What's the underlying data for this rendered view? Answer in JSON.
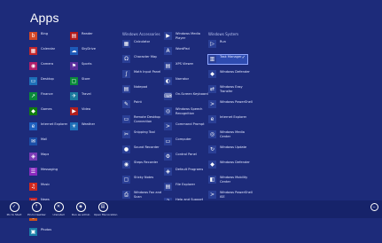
{
  "screen": {
    "title": "Apps"
  },
  "columns": [
    {
      "header": "",
      "tiles": [
        {
          "label": "Bing",
          "icon": "bing-icon",
          "color": "#d24726",
          "glyph": "b"
        },
        {
          "label": "Calendar",
          "icon": "calendar-icon",
          "color": "#c1272d",
          "glyph": "▦"
        },
        {
          "label": "Camera",
          "icon": "camera-icon",
          "color": "#b01e6a",
          "glyph": "◉"
        },
        {
          "label": "Desktop",
          "icon": "desktop-icon",
          "color": "#1e6fb8",
          "glyph": "▭"
        },
        {
          "label": "Finance",
          "icon": "finance-icon",
          "color": "#0a8a3a",
          "glyph": "↗"
        },
        {
          "label": "Games",
          "icon": "games-icon",
          "color": "#107c10",
          "glyph": "◆"
        },
        {
          "label": "Internet Explorer",
          "icon": "internet-explorer-icon",
          "color": "#1f5fbf",
          "glyph": "e"
        },
        {
          "label": "Mail",
          "icon": "mail-icon",
          "color": "#1b4fa8",
          "glyph": "✉"
        },
        {
          "label": "Maps",
          "icon": "maps-icon",
          "color": "#7a3bb5",
          "glyph": "◈"
        },
        {
          "label": "Messaging",
          "icon": "messaging-icon",
          "color": "#8a2bbf",
          "glyph": "☰"
        },
        {
          "label": "Music",
          "icon": "music-icon",
          "color": "#d1281e",
          "glyph": "♫"
        },
        {
          "label": "News",
          "icon": "news-icon",
          "color": "#c1272d",
          "glyph": "▤"
        },
        {
          "label": "People",
          "icon": "people-icon",
          "color": "#c9511a",
          "glyph": "☺"
        },
        {
          "label": "Photos",
          "icon": "photos-icon",
          "color": "#1a7fa8",
          "glyph": "▣"
        }
      ]
    },
    {
      "header": "",
      "tiles": [
        {
          "label": "Reader",
          "icon": "reader-icon",
          "color": "#b31a1a",
          "glyph": "▤"
        },
        {
          "label": "SkyDrive",
          "icon": "skydrive-icon",
          "color": "#1e5ab8",
          "glyph": "☁"
        },
        {
          "label": "Sports",
          "icon": "sports-icon",
          "color": "#5a2d9c",
          "glyph": "⚑"
        },
        {
          "label": "Store",
          "icon": "store-icon",
          "color": "#0a8a3a",
          "glyph": "▢"
        },
        {
          "label": "Travel",
          "icon": "travel-icon",
          "color": "#1b7a9e",
          "glyph": "✈"
        },
        {
          "label": "Video",
          "icon": "video-icon",
          "color": "#b01e1e",
          "glyph": "▶"
        },
        {
          "label": "Weather",
          "icon": "weather-icon",
          "color": "#1e6fb8",
          "glyph": "☀"
        }
      ]
    },
    {
      "header": "Windows Accessories",
      "tiles": [
        {
          "label": "Calculator",
          "icon": "calculator-icon",
          "color": "#2a3f96",
          "glyph": "▦"
        },
        {
          "label": "Character Map",
          "icon": "character-map-icon",
          "color": "#2a3f96",
          "glyph": "Ω"
        },
        {
          "label": "Math Input Panel",
          "icon": "math-input-panel-icon",
          "color": "#2a3f96",
          "glyph": "∫"
        },
        {
          "label": "Notepad",
          "icon": "notepad-icon",
          "color": "#2a3f96",
          "glyph": "▤"
        },
        {
          "label": "Paint",
          "icon": "paint-icon",
          "color": "#2a3f96",
          "glyph": "✎"
        },
        {
          "label": "Remote Desktop Connection",
          "icon": "remote-desktop-icon",
          "color": "#2a3f96",
          "glyph": "▭"
        },
        {
          "label": "Snipping Tool",
          "icon": "snipping-tool-icon",
          "color": "#2a3f96",
          "glyph": "✂"
        },
        {
          "label": "Sound Recorder",
          "icon": "sound-recorder-icon",
          "color": "#2a3f96",
          "glyph": "●"
        },
        {
          "label": "Steps Recorder",
          "icon": "steps-recorder-icon",
          "color": "#2a3f96",
          "glyph": "◉"
        },
        {
          "label": "Sticky Notes",
          "icon": "sticky-notes-icon",
          "color": "#2a3f96",
          "glyph": "▢"
        },
        {
          "label": "Windows Fax and Scan",
          "icon": "fax-scan-icon",
          "color": "#2a3f96",
          "glyph": "⎙"
        },
        {
          "label": "Windows Journal",
          "icon": "windows-journal-icon",
          "color": "#2a3f96",
          "glyph": "✎"
        }
      ]
    },
    {
      "header": "",
      "tiles": [
        {
          "label": "Windows Media Player",
          "icon": "media-player-icon",
          "color": "#2a3f96",
          "glyph": "▶"
        },
        {
          "label": "WordPad",
          "icon": "wordpad-icon",
          "color": "#2a3f96",
          "glyph": "A"
        },
        {
          "label": "XPS Viewer",
          "icon": "xps-viewer-icon",
          "color": "#2a3f96",
          "glyph": "▤"
        },
        {
          "label": "Narrator",
          "icon": "narrator-icon",
          "color": "#2a3f96",
          "glyph": "◐"
        },
        {
          "label": "On-Screen Keyboard",
          "icon": "on-screen-keyboard-icon",
          "color": "#2a3f96",
          "glyph": "⌨"
        },
        {
          "label": "Windows Speech Recognition",
          "icon": "speech-recognition-icon",
          "color": "#2a3f96",
          "glyph": "◎"
        },
        {
          "label": "Command Prompt",
          "icon": "command-prompt-icon",
          "color": "#2a3f96",
          "glyph": ">"
        },
        {
          "label": "Computer",
          "icon": "computer-icon",
          "color": "#2a3f96",
          "glyph": "▭"
        },
        {
          "label": "Control Panel",
          "icon": "control-panel-icon",
          "color": "#2a3f96",
          "glyph": "⚙"
        },
        {
          "label": "Default Programs",
          "icon": "default-programs-icon",
          "color": "#2a3f96",
          "glyph": "◈"
        },
        {
          "label": "File Explorer",
          "icon": "file-explorer-icon",
          "color": "#2a3f96",
          "glyph": "▤"
        },
        {
          "label": "Help and Support",
          "icon": "help-icon",
          "color": "#2a3f96",
          "glyph": "?"
        }
      ]
    },
    {
      "header": "Windows System",
      "tiles": [
        {
          "label": "Run",
          "icon": "run-icon",
          "color": "#2a3f96",
          "glyph": "▷"
        },
        {
          "label": "Task Manager",
          "icon": "task-manager-icon",
          "color": "#2a3f96",
          "glyph": "▥",
          "selected": true
        },
        {
          "label": "Windows Defender",
          "icon": "windows-defender-icon",
          "color": "#2a3f96",
          "glyph": "◆"
        },
        {
          "label": "Windows Easy Transfer",
          "icon": "easy-transfer-icon",
          "color": "#2a3f96",
          "glyph": "⇄"
        },
        {
          "label": "Windows PowerShell",
          "icon": "powershell-icon",
          "color": "#2a3f96",
          "glyph": ">"
        },
        {
          "label": "Internet Explorer",
          "icon": "ie-desktop-icon",
          "color": "#2a3f96",
          "glyph": "e"
        },
        {
          "label": "Windows Media Center",
          "icon": "media-center-icon",
          "color": "#2a3f96",
          "glyph": "◎"
        },
        {
          "label": "Windows Update",
          "icon": "windows-update-icon",
          "color": "#2a3f96",
          "glyph": "↻"
        },
        {
          "label": "Windows Defender",
          "icon": "windows-defender-2-icon",
          "color": "#2a3f96",
          "glyph": "◆"
        },
        {
          "label": "Windows Mobility Center",
          "icon": "mobility-center-icon",
          "color": "#2a3f96",
          "glyph": "◧"
        },
        {
          "label": "Windows PowerShell ISE",
          "icon": "powershell-ise-icon",
          "color": "#2a3f96",
          "glyph": ">"
        }
      ]
    }
  ],
  "app_bar": {
    "buttons": [
      {
        "label": "Pin to Start",
        "icon": "pin-icon",
        "glyph": "✓"
      },
      {
        "label": "Pin to taskbar",
        "icon": "taskbar-pin-icon",
        "glyph": "⇡"
      },
      {
        "label": "Uninstall",
        "icon": "uninstall-icon",
        "glyph": "✕"
      },
      {
        "label": "Run as admin",
        "icon": "run-as-admin-icon",
        "glyph": "◈"
      },
      {
        "label": "Open file location",
        "icon": "open-location-icon",
        "glyph": "▤"
      }
    ],
    "corner_button": {
      "label": "",
      "icon": "zoom-out-icon",
      "glyph": "−"
    }
  }
}
